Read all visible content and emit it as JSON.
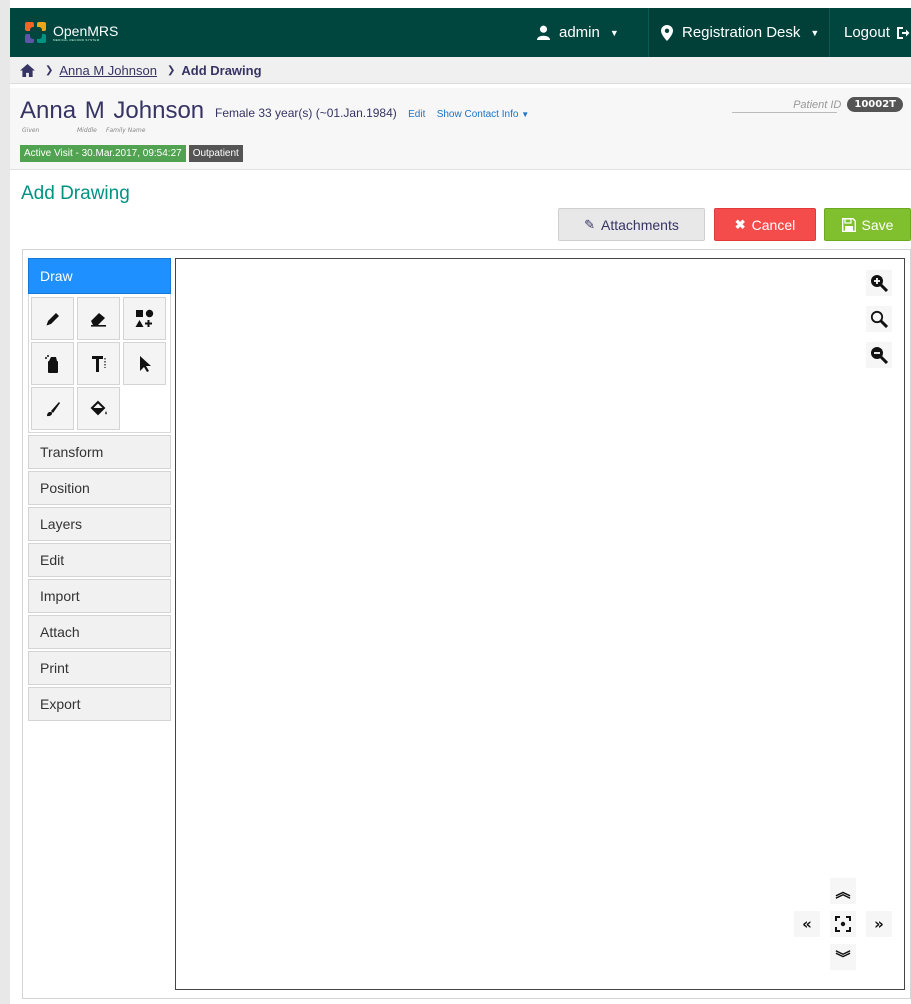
{
  "header": {
    "app_name": "OpenMRS",
    "app_tagline": "MEDICAL RECORD SYSTEM",
    "user": "admin",
    "location": "Registration Desk",
    "logout": "Logout"
  },
  "breadcrumb": {
    "patient": "Anna M Johnson",
    "current": "Add Drawing"
  },
  "patient": {
    "given": "Anna",
    "middle": "M",
    "family": "Johnson",
    "label_given": "Given",
    "label_middle": "Middle",
    "label_family": "Family Name",
    "gender": "Female",
    "age": "33 year(s) (~01.Jan.1984)",
    "edit": "Edit",
    "show_contact": "Show Contact Info",
    "patient_id_label": "Patient ID",
    "patient_id": "10002T",
    "visit_badge": "Active Visit - 30.Mar.2017, 09:54:27",
    "visit_type": "Outpatient"
  },
  "page": {
    "title": "Add Drawing"
  },
  "buttons": {
    "attachments": "Attachments",
    "cancel": "Cancel",
    "save": "Save"
  },
  "menu": {
    "active": "Draw",
    "tools": [
      "pencil-icon",
      "eraser-icon",
      "shapes-icon",
      "spray-icon",
      "text-icon",
      "select-icon",
      "brush-icon",
      "fill-icon"
    ],
    "items": [
      "Transform",
      "Position",
      "Layers",
      "Edit",
      "Import",
      "Attach",
      "Print",
      "Export"
    ]
  },
  "colors": {
    "header_bg": "#00463f",
    "accent_teal": "#009384",
    "draw_blue": "#1e90ff",
    "cancel_red": "#f44b4b",
    "save_green": "#80c02e",
    "visit_green": "#51a351"
  }
}
